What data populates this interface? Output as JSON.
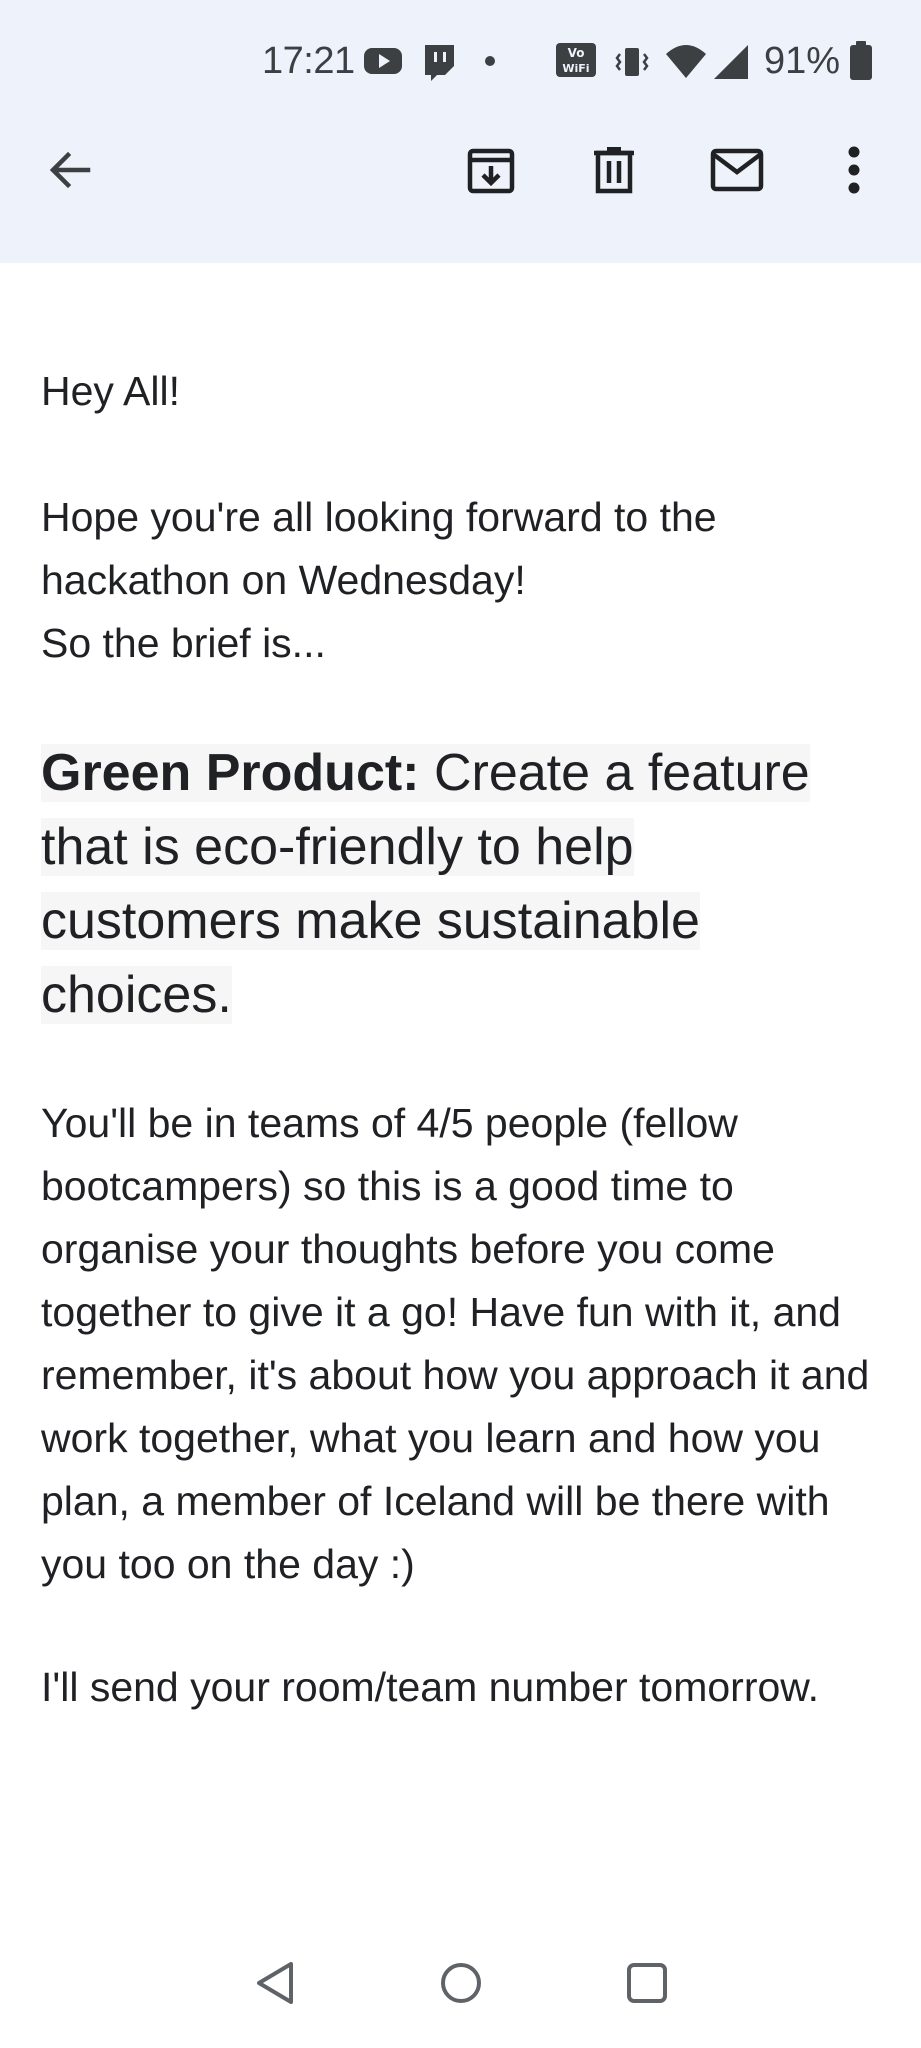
{
  "status_bar": {
    "time": "17:21",
    "battery": "91%",
    "icons": [
      "youtube-icon",
      "twitch-icon",
      "dot-icon",
      "vowifi-icon",
      "vibrate-icon",
      "wifi-icon",
      "signal-icon",
      "battery-icon"
    ],
    "vowifi_text": [
      "Vo",
      "WiFi"
    ]
  },
  "toolbar": {
    "back": "back-arrow-icon",
    "archive": "archive-icon",
    "delete": "trash-icon",
    "mark_unread": "mail-icon",
    "more": "more-vert-icon"
  },
  "email": {
    "greeting": "Hey All!",
    "intro_line1": "Hope you're all looking forward to the hackathon on Wednesday!",
    "intro_line2": "So the brief is...",
    "brief_title": "Green Product:",
    "brief_text": " Create a feature that is eco-friendly to help customers make sustainable choices.",
    "details": "You'll be in teams of 4/5 people (fellow bootcampers) so this is a good time to organise your thoughts before you come together to give it a go! Have fun with it, and remember, it's about how you approach it and work together, what you learn and how you plan, a member of Iceland will be there with you too on the day :)",
    "closing": "I'll send your room/team number tomorrow."
  },
  "nav_bar": {
    "back": "nav-back-icon",
    "home": "nav-home-icon",
    "recents": "nav-recents-icon"
  },
  "colors": {
    "header_bg": "#eef2fa",
    "text": "#202124",
    "icon": "#3c4043",
    "highlight_bg": "#f6f6f6"
  }
}
